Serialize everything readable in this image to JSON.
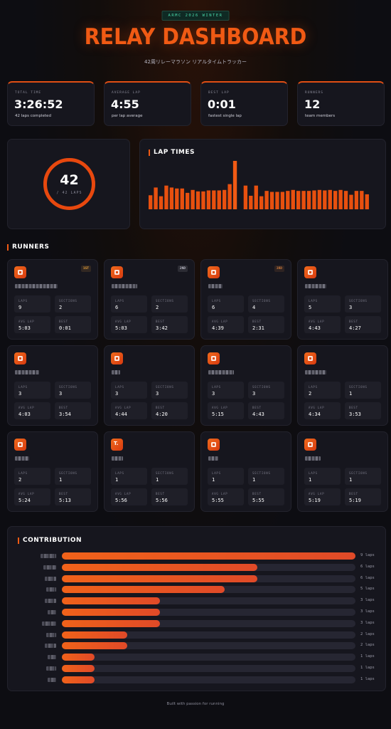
{
  "header": {
    "badge": "ARMC 2026 WINTER",
    "title": "RELAY DASHBOARD",
    "subtitle": "42周リレーマラソン リアルタイムトラッカー"
  },
  "stats": [
    {
      "label": "TOTAL TIME",
      "value": "3:26:52",
      "sub": "42 laps completed"
    },
    {
      "label": "AVERAGE LAP",
      "value": "4:55",
      "sub": "per lap average"
    },
    {
      "label": "BEST LAP",
      "value": "0:01",
      "sub": "fastest single lap"
    },
    {
      "label": "RUNNERS",
      "value": "12",
      "sub": "team members"
    }
  ],
  "progress": {
    "completed": "42",
    "total_label": "/ 42 LAPS",
    "fraction": 1.0,
    "color": "#e8480e"
  },
  "lap_times": {
    "title": "LAP TIMES",
    "relative_values": [
      0.29,
      0.45,
      0.27,
      0.49,
      0.45,
      0.43,
      0.43,
      0.34,
      0.4,
      0.37,
      0.37,
      0.39,
      0.39,
      0.39,
      0.4,
      0.52,
      1.0,
      0.0,
      0.49,
      0.28,
      0.49,
      0.27,
      0.38,
      0.36,
      0.36,
      0.36,
      0.38,
      0.4,
      0.38,
      0.38,
      0.38,
      0.39,
      0.4,
      0.39,
      0.4,
      0.38,
      0.4,
      0.38,
      0.3,
      0.38,
      0.38,
      0.31
    ]
  },
  "runners_section": {
    "title": "RUNNERS"
  },
  "labels": {
    "laps": "LAPS",
    "sections": "SECTIONS",
    "avg_lap": "AVG LAP",
    "best": "BEST"
  },
  "runners": [
    {
      "rank": "1ST",
      "rank_color": "#e8a13a",
      "laps": "9",
      "sections": "2",
      "avg": "5:03",
      "best": "0:01",
      "glyph": "grid"
    },
    {
      "rank": "2ND",
      "rank_color": "#b8b8c4",
      "laps": "6",
      "sections": "2",
      "avg": "5:03",
      "best": "3:42",
      "glyph": "grid"
    },
    {
      "rank": "3RD",
      "rank_color": "#c8773a",
      "laps": "6",
      "sections": "4",
      "avg": "4:39",
      "best": "2:31",
      "glyph": "grid"
    },
    {
      "rank": "",
      "rank_color": "",
      "laps": "5",
      "sections": "3",
      "avg": "4:43",
      "best": "4:27",
      "glyph": "grid"
    },
    {
      "rank": "",
      "rank_color": "",
      "laps": "3",
      "sections": "3",
      "avg": "4:03",
      "best": "3:54",
      "glyph": "grid"
    },
    {
      "rank": "",
      "rank_color": "",
      "laps": "3",
      "sections": "3",
      "avg": "4:44",
      "best": "4:20",
      "glyph": "grid"
    },
    {
      "rank": "",
      "rank_color": "",
      "laps": "3",
      "sections": "3",
      "avg": "5:15",
      "best": "4:43",
      "glyph": "grid"
    },
    {
      "rank": "",
      "rank_color": "",
      "laps": "2",
      "sections": "1",
      "avg": "4:34",
      "best": "3:53",
      "glyph": "grid"
    },
    {
      "rank": "",
      "rank_color": "",
      "laps": "2",
      "sections": "1",
      "avg": "5:24",
      "best": "5:13",
      "glyph": "grid"
    },
    {
      "rank": "",
      "rank_color": "",
      "laps": "1",
      "sections": "1",
      "avg": "5:56",
      "best": "5:56",
      "glyph": "T."
    },
    {
      "rank": "",
      "rank_color": "",
      "laps": "1",
      "sections": "1",
      "avg": "5:55",
      "best": "5:55",
      "glyph": "grid"
    },
    {
      "rank": "",
      "rank_color": "",
      "laps": "1",
      "sections": "1",
      "avg": "5:19",
      "best": "5:19",
      "glyph": "grid"
    }
  ],
  "contribution": {
    "title": "CONTRIBUTION",
    "max": 9,
    "rows": [
      {
        "laps": 9,
        "label": "9 laps"
      },
      {
        "laps": 6,
        "label": "6 laps"
      },
      {
        "laps": 6,
        "label": "6 laps"
      },
      {
        "laps": 5,
        "label": "5 laps"
      },
      {
        "laps": 3,
        "label": "3 laps"
      },
      {
        "laps": 3,
        "label": "3 laps"
      },
      {
        "laps": 3,
        "label": "3 laps"
      },
      {
        "laps": 2,
        "label": "2 laps"
      },
      {
        "laps": 2,
        "label": "2 laps"
      },
      {
        "laps": 1,
        "label": "1 laps"
      },
      {
        "laps": 1,
        "label": "1 laps"
      },
      {
        "laps": 1,
        "label": "1 laps"
      }
    ]
  },
  "footer": "Built with passion for running"
}
